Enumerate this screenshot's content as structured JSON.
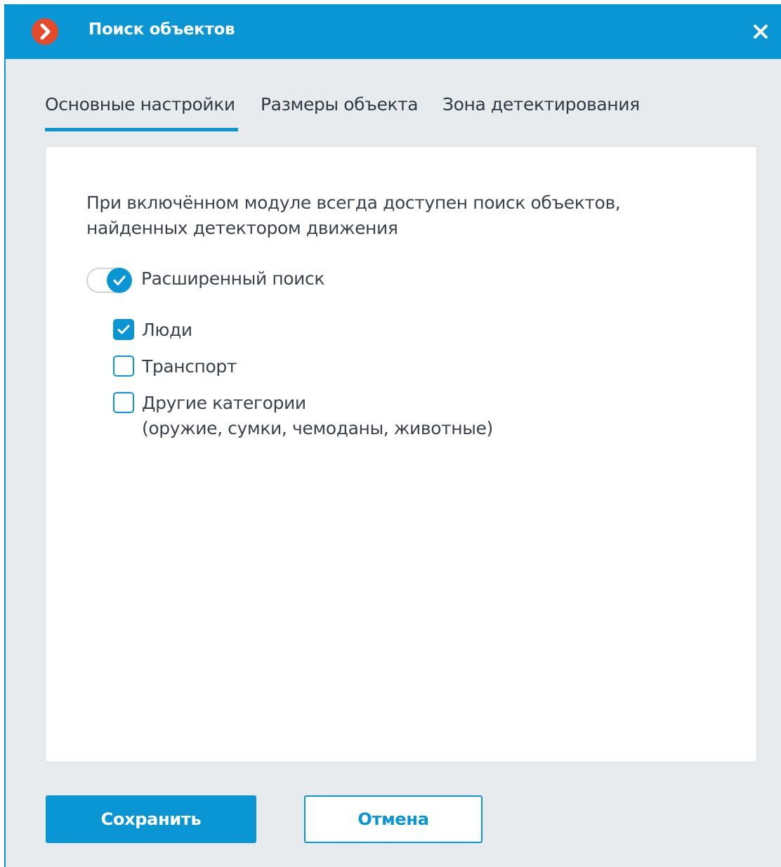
{
  "window": {
    "title": "Поиск объектов",
    "accent_color": "#0a96d4",
    "logo_color": "#e54b2a"
  },
  "icons": {
    "logo": "chevron-right-icon",
    "close": "close-icon",
    "check": "check-icon"
  },
  "tabs": [
    {
      "label": "Основные настройки",
      "active": true
    },
    {
      "label": "Размеры объекта",
      "active": false
    },
    {
      "label": "Зона детектирования",
      "active": false
    }
  ],
  "settings": {
    "info_line1": "При включённом модуле всегда доступен поиск объектов,",
    "info_line2": "найденных детектором движения",
    "advanced_search": {
      "label": "Расширенный поиск",
      "enabled": true
    },
    "categories": [
      {
        "label": "Люди",
        "checked": true
      },
      {
        "label": "Транспорт",
        "checked": false
      },
      {
        "label": "Другие категории",
        "sublabel": "(оружие, сумки, чемоданы, животные)",
        "checked": false
      }
    ]
  },
  "buttons": {
    "save_label": "Сохранить",
    "cancel_label": "Отмена"
  }
}
